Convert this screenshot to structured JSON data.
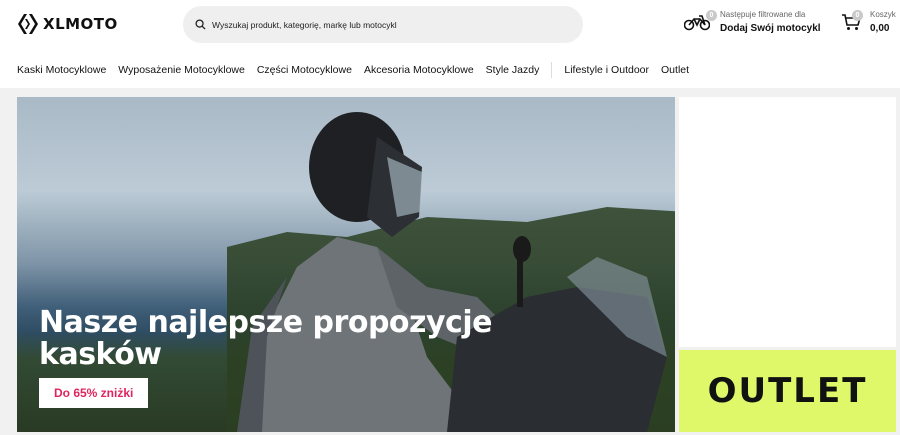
{
  "brand": {
    "logo_text": "XLMOTO"
  },
  "search": {
    "placeholder": "Wyszukaj produkt, kategorię, markę lub motocykl"
  },
  "garage": {
    "count": "0",
    "caption": "Następuje filtrowane dla",
    "action": "Dodaj Swój motocykl"
  },
  "cart": {
    "count": "0",
    "label": "Koszyk",
    "total": "0,00"
  },
  "nav": {
    "items": [
      {
        "label": "Kaski Motocyklowe"
      },
      {
        "label": "Wyposażenie Motocyklowe"
      },
      {
        "label": "Części Motocyklowe"
      },
      {
        "label": "Akcesoria Motocyklowe"
      },
      {
        "label": "Style Jazdy"
      },
      {
        "label": "Lifestyle i Outdoor"
      },
      {
        "label": "Outlet"
      }
    ]
  },
  "hero": {
    "title": "Nasze najlepsze propozycje kasków",
    "button": "Do 65% zniżki"
  },
  "promo": {
    "outlet_label": "OUTLET",
    "accent_color": "#dff86a"
  },
  "colors": {
    "discount_text": "#e0245e"
  }
}
